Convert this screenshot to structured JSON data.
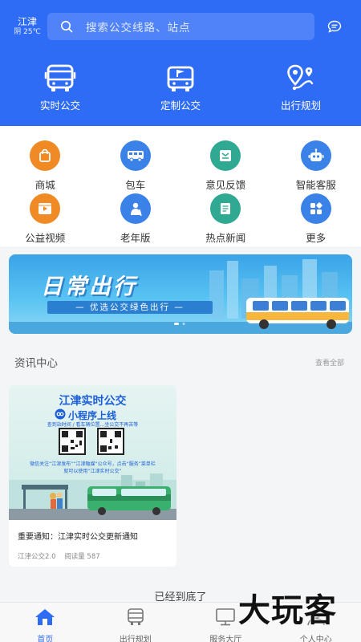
{
  "header": {
    "city": "江津",
    "weather": "阴 25℃",
    "search_placeholder": "搜索公交线路、站点"
  },
  "top_nav": [
    {
      "label": "实时公交",
      "icon": "bus-front-icon"
    },
    {
      "label": "定制公交",
      "icon": "custom-bus-icon"
    },
    {
      "label": "出行规划",
      "icon": "route-pin-icon"
    }
  ],
  "grid": [
    {
      "label": "商城",
      "icon": "shopping-bag-icon",
      "color": "#f08a24"
    },
    {
      "label": "包车",
      "icon": "charter-bus-icon",
      "color": "#3b82e8"
    },
    {
      "label": "意见反馈",
      "icon": "feedback-icon",
      "color": "#2fa992"
    },
    {
      "label": "智能客服",
      "icon": "robot-icon",
      "color": "#3b82e8"
    },
    {
      "label": "公益视频",
      "icon": "video-icon",
      "color": "#f08a24"
    },
    {
      "label": "老年版",
      "icon": "elderly-icon",
      "color": "#3b82e8"
    },
    {
      "label": "热点新闻",
      "icon": "news-icon",
      "color": "#2fa992"
    },
    {
      "label": "更多",
      "icon": "more-icon",
      "color": "#3b82e8"
    }
  ],
  "banner": {
    "title": "日常出行",
    "subtitle": "— 优选公交绿色出行 —"
  },
  "news": {
    "heading": "资讯中心",
    "view_all": "查看全部",
    "card": {
      "image_title": "江津实时公交",
      "image_subtitle": "小程序上线",
      "image_tagline": "查到站时间 / 看车辆位置...坐公交不再苦等",
      "image_note1": "微信关注“江津发布”“江津融媒”公众号，点击“服务”菜单栏",
      "image_note2": "就可以使用“江津实时公交”",
      "headline": "重要通知：江津实时公交更新通知",
      "source": "江津公交2.0",
      "reads": "阅读量 587"
    }
  },
  "footer_text": "已经到底了",
  "tabs": [
    {
      "label": "首页",
      "icon": "home-icon",
      "active": true
    },
    {
      "label": "出行规划",
      "icon": "bus-icon",
      "active": false
    },
    {
      "label": "服务大厅",
      "icon": "monitor-icon",
      "active": false
    },
    {
      "label": "个人中心",
      "icon": "user-icon",
      "active": false
    }
  ],
  "watermark": "大玩客",
  "colors": {
    "primary": "#2f6cf6",
    "orange": "#f08a24",
    "teal": "#2fa992"
  }
}
